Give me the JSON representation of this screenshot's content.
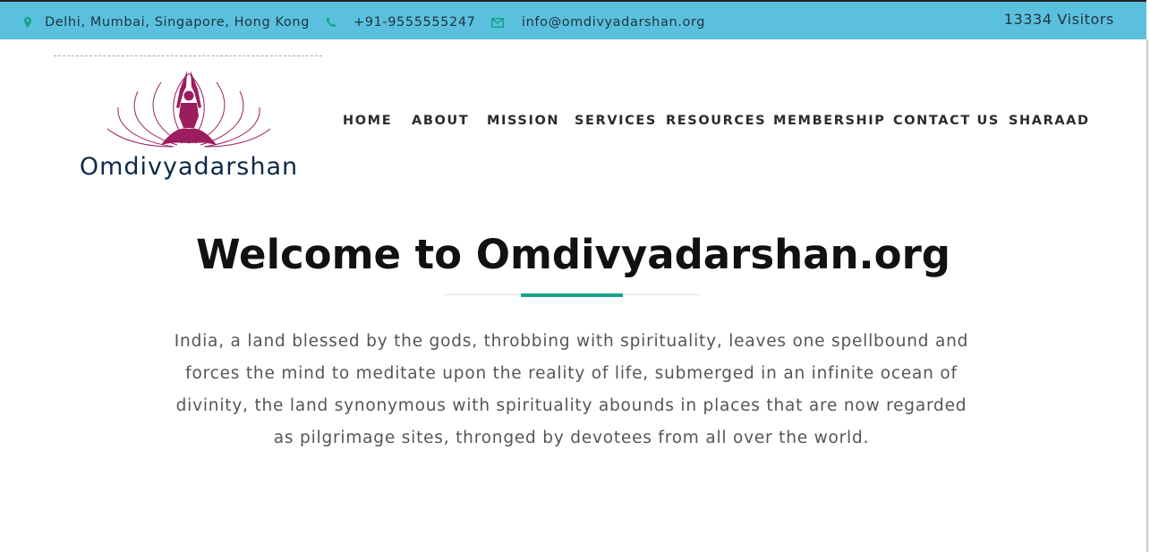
{
  "topbar": {
    "location": "Delhi, Mumbai, Singapore, Hong Kong",
    "phone": "+91-9555555247",
    "email": "info@omdivyadarshan.org",
    "visitors": "13334 Visitors",
    "icon_color": "#14a38a",
    "background": "#5bc0de"
  },
  "logo": {
    "text": "Omdivyadarshan",
    "icon": "meditating-figure-lotus-icon",
    "primary_color": "#9b1d5e"
  },
  "nav": {
    "items": [
      "HOME",
      "ABOUT",
      "MISSION",
      "SERVICES",
      "RESOURCES",
      "MEMBERSHIP",
      "CONTACT US",
      "SHARAAD"
    ]
  },
  "main": {
    "title": "Welcome to Omdivyadarshan.org",
    "accent_color": "#14a38a",
    "paragraph_lines": [
      "India, a land blessed by the gods, throbbing with spirituality, leaves one spellbound and",
      "forces the mind to meditate upon the reality of life, submerged in an infinite ocean of",
      "divinity, the land synonymous with spirituality abounds in places that are now regarded",
      "as pilgrimage sites, thronged by devotees from all over the world."
    ]
  }
}
